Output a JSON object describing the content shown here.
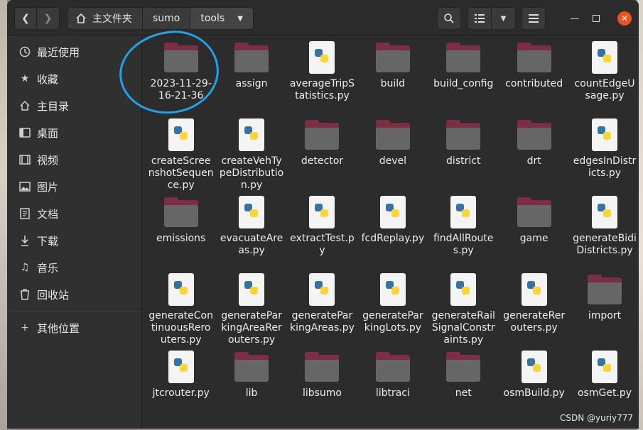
{
  "breadcrumbs": {
    "home": "主文件夹",
    "sumo": "sumo",
    "tools": "tools"
  },
  "sidebar": {
    "items": [
      {
        "label": "最近使用",
        "icon": "clock-icon"
      },
      {
        "label": "收藏",
        "icon": "star-icon"
      },
      {
        "label": "主目录",
        "icon": "home-icon"
      },
      {
        "label": "桌面",
        "icon": "desktop-icon"
      },
      {
        "label": "视频",
        "icon": "video-icon"
      },
      {
        "label": "图片",
        "icon": "image-icon"
      },
      {
        "label": "文档",
        "icon": "document-icon"
      },
      {
        "label": "下载",
        "icon": "download-icon"
      },
      {
        "label": "音乐",
        "icon": "music-icon"
      },
      {
        "label": "回收站",
        "icon": "trash-icon"
      }
    ],
    "other": {
      "label": "其他位置",
      "icon": "plus-icon"
    }
  },
  "files": [
    {
      "name": "2023-11-29-16-21-36",
      "type": "folder"
    },
    {
      "name": "assign",
      "type": "folder"
    },
    {
      "name": "averageTripStatistics.py",
      "type": "python"
    },
    {
      "name": "build",
      "type": "folder"
    },
    {
      "name": "build_config",
      "type": "folder"
    },
    {
      "name": "contributed",
      "type": "folder"
    },
    {
      "name": "countEdgeUsage.py",
      "type": "python"
    },
    {
      "name": "createScreenshotSequence.py",
      "type": "python"
    },
    {
      "name": "createVehTypeDistribution.py",
      "type": "python"
    },
    {
      "name": "detector",
      "type": "folder"
    },
    {
      "name": "devel",
      "type": "folder"
    },
    {
      "name": "district",
      "type": "folder"
    },
    {
      "name": "drt",
      "type": "folder"
    },
    {
      "name": "edgesInDistricts.py",
      "type": "python"
    },
    {
      "name": "emissions",
      "type": "folder"
    },
    {
      "name": "evacuateAreas.py",
      "type": "python"
    },
    {
      "name": "extractTest.py",
      "type": "python"
    },
    {
      "name": "fcdReplay.py",
      "type": "python"
    },
    {
      "name": "findAllRoutes.py",
      "type": "python"
    },
    {
      "name": "game",
      "type": "folder"
    },
    {
      "name": "generateBidiDistricts.py",
      "type": "python"
    },
    {
      "name": "generateContinuousRerouters.py",
      "type": "python"
    },
    {
      "name": "generateParkingAreaRerouters.py",
      "type": "python"
    },
    {
      "name": "generateParkingAreas.py",
      "type": "python"
    },
    {
      "name": "generateParkingLots.py",
      "type": "python"
    },
    {
      "name": "generateRailSignalConstraints.py",
      "type": "python"
    },
    {
      "name": "generateRerouters.py",
      "type": "python"
    },
    {
      "name": "import",
      "type": "folder"
    },
    {
      "name": "jtcrouter.py",
      "type": "python"
    },
    {
      "name": "lib",
      "type": "folder"
    },
    {
      "name": "libsumo",
      "type": "folder"
    },
    {
      "name": "libtraci",
      "type": "folder"
    },
    {
      "name": "net",
      "type": "folder"
    },
    {
      "name": "osmBuild.py",
      "type": "python"
    },
    {
      "name": "osmGet.py",
      "type": "python"
    }
  ],
  "watermark": "CSDN @yuriy777",
  "colors": {
    "folder_tab": "#7c2e44",
    "close_button": "#e95420",
    "annotation": "#22a1e8"
  }
}
